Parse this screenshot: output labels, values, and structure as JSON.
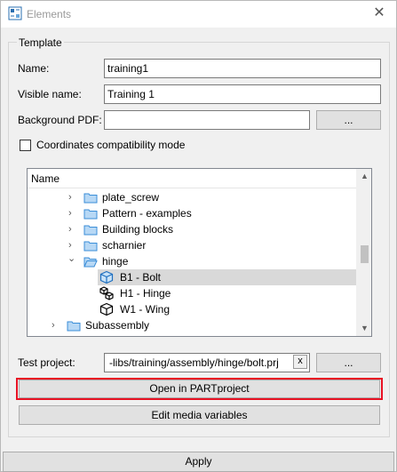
{
  "window": {
    "title": "Elements",
    "close_glyph": "✕"
  },
  "template": {
    "group_title": "Template",
    "name_label": "Name:",
    "name_value": "training1",
    "visible_name_label": "Visible name:",
    "visible_name_value": "Training 1",
    "bg_pdf_label": "Background PDF:",
    "bg_pdf_value": "",
    "browse_label": "...",
    "coords_label": "Coordinates compatibility mode",
    "coords_checked": false
  },
  "tree": {
    "header": "Name",
    "items": [
      {
        "label": "plate_screw",
        "icon": "folder-icon",
        "expander": "›"
      },
      {
        "label": "Pattern - examples",
        "icon": "folder-icon",
        "expander": "›"
      },
      {
        "label": "Building blocks",
        "icon": "folder-icon",
        "expander": "›"
      },
      {
        "label": "scharnier",
        "icon": "folder-icon",
        "expander": "›"
      },
      {
        "label": "hinge",
        "icon": "folder-open-icon",
        "expander": "⌄"
      },
      {
        "label": "B1 - Bolt",
        "icon": "part-cube-icon",
        "expander": "",
        "selected": true
      },
      {
        "label": "H1 - Hinge",
        "icon": "assembly-icon",
        "expander": ""
      },
      {
        "label": "W1 - Wing",
        "icon": "part-cube-icon",
        "expander": ""
      },
      {
        "label": "Subassembly",
        "icon": "folder-icon",
        "expander": "›"
      }
    ]
  },
  "test_project": {
    "label": "Test project:",
    "value": "-libs/training/assembly/hinge/bolt.prj",
    "clear_glyph": "x",
    "browse_label": "..."
  },
  "buttons": {
    "open_partproject": "Open in PARTproject",
    "edit_media": "Edit media variables",
    "apply": "Apply"
  },
  "colors": {
    "highlight_border": "#e81123",
    "selection": "#d9d9d9",
    "folder": "#3b8ed8"
  }
}
